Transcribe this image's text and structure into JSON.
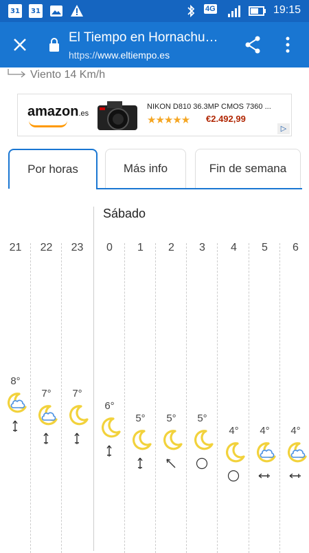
{
  "status": {
    "time": "19:15",
    "notif_1": "31",
    "notif_2": "31",
    "network": "4G"
  },
  "appbar": {
    "title": "El Tiempo en Hornachu…",
    "url_scheme": "https://",
    "url_host": "www.eltiempo.es"
  },
  "wind_text": "Viento 14 Km/h",
  "ad": {
    "brand": "amazon",
    "brand_suffix": ".es",
    "product": "NIKON D810 36.3MP CMOS 7360 ...",
    "stars": "★★★★★",
    "price": "€2.492,99"
  },
  "tabs": [
    {
      "label": "Por horas",
      "active": true
    },
    {
      "label": "Más info",
      "active": false
    },
    {
      "label": "Fin de semana",
      "active": false
    }
  ],
  "day_label": "Sábado",
  "hours": [
    {
      "hour": "21",
      "temp": "8°",
      "icon": "moon-cloud-icon",
      "wind": "wind-north-icon",
      "temp_c": 8
    },
    {
      "hour": "22",
      "temp": "7°",
      "icon": "moon-cloud-icon",
      "wind": "wind-north-icon",
      "temp_c": 7
    },
    {
      "hour": "23",
      "temp": "7°",
      "icon": "moon-icon",
      "wind": "wind-north-icon",
      "temp_c": 7
    },
    {
      "hour": "0",
      "temp": "6°",
      "icon": "moon-icon",
      "wind": "wind-north-icon",
      "temp_c": 6
    },
    {
      "hour": "1",
      "temp": "5°",
      "icon": "moon-icon",
      "wind": "wind-north-icon",
      "temp_c": 5
    },
    {
      "hour": "2",
      "temp": "5°",
      "icon": "moon-icon",
      "wind": "wind-northwest-icon",
      "temp_c": 5
    },
    {
      "hour": "3",
      "temp": "5°",
      "icon": "moon-icon",
      "wind": "calm-icon",
      "temp_c": 5
    },
    {
      "hour": "4",
      "temp": "4°",
      "icon": "moon-icon",
      "wind": "calm-icon",
      "temp_c": 4
    },
    {
      "hour": "5",
      "temp": "4°",
      "icon": "moon-cloud-icon",
      "wind": "wind-west-icon",
      "temp_c": 4
    },
    {
      "hour": "6",
      "temp": "4°",
      "icon": "moon-cloud-icon",
      "wind": "wind-west-icon",
      "temp_c": 4
    }
  ],
  "colors": {
    "primary": "#1976d2",
    "statusbar": "#1565c0",
    "moon": "#f2d23c",
    "cloud": "#4a90e2"
  }
}
